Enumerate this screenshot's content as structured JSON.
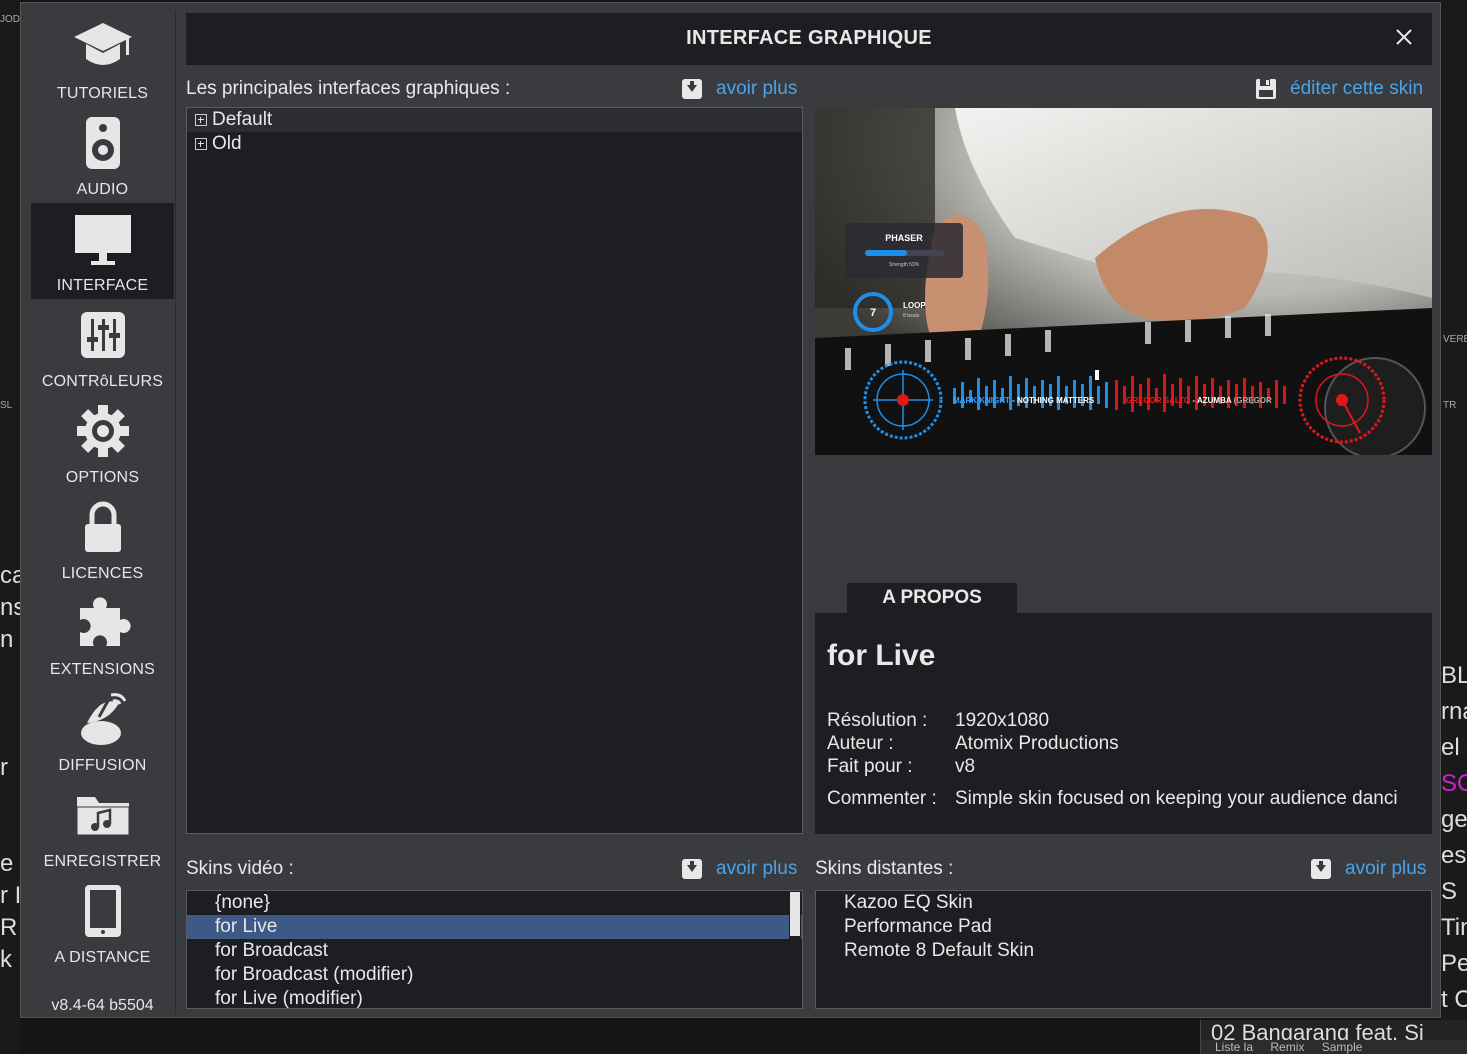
{
  "dialog": {
    "title": "INTERFACE GRAPHIQUE",
    "version": "v8.4-64 b5504"
  },
  "sidebar": {
    "items": [
      {
        "label": "TUTORIELS",
        "icon": "graduation-cap-icon"
      },
      {
        "label": "AUDIO",
        "icon": "speaker-icon"
      },
      {
        "label": "INTERFACE",
        "icon": "monitor-icon",
        "active": true
      },
      {
        "label": "CONTRôLEURS",
        "icon": "mixer-sliders-icon"
      },
      {
        "label": "OPTIONS",
        "icon": "gear-icon"
      },
      {
        "label": "LICENCES",
        "icon": "lock-icon"
      },
      {
        "label": "EXTENSIONS",
        "icon": "puzzle-icon"
      },
      {
        "label": "DIFFUSION",
        "icon": "satellite-dish-icon"
      },
      {
        "label": "ENREGISTRER",
        "icon": "music-folder-icon"
      },
      {
        "label": "A DISTANCE",
        "icon": "tablet-icon"
      }
    ]
  },
  "main_skins": {
    "label": "Les principales interfaces graphiques :",
    "more_link": "avoir plus",
    "edit_link": "éditer cette skin",
    "tree": [
      "Default",
      "Old"
    ]
  },
  "preview": {
    "fx_name": "PHASER",
    "fx_strength": "Strength 53%",
    "fx_level": 0.53,
    "loop_count": "7",
    "loop_label": "LOOP",
    "loop_sub": "8 beats",
    "deck_left_artist": "MARK KNIGHT",
    "deck_left_title": "- NOTHING MATTERS",
    "deck_right_artist": "GREGOR SALTO",
    "deck_right_title": "- AZUMBA",
    "deck_right_extra": "(GREGOR"
  },
  "about": {
    "tab": "A PROPOS",
    "name": "for Live",
    "resolution_label": "Résolution :",
    "resolution": "1920x1080",
    "author_label": "Auteur :",
    "author": "Atomix Productions",
    "made_for_label": "Fait pour :",
    "made_for": "v8",
    "comment_label": "Commenter :",
    "comment": "Simple skin focused on keeping your audience danci"
  },
  "video_skins": {
    "label": "Skins vidéo :",
    "more_link": "avoir plus",
    "items": [
      "{none}",
      "for Live",
      "for Broadcast",
      "for Broadcast (modifier)",
      "for Live (modifier)"
    ],
    "selected_index": 1
  },
  "remote_skins": {
    "label": "Skins distantes :",
    "more_link": "avoir plus",
    "items": [
      "Kazoo EQ Skin",
      "Performance Pad",
      "Remote 8 Default Skin"
    ]
  },
  "background": {
    "left_frags": [
      "JOD",
      "SL",
      "ca",
      "ns",
      "n I",
      "r",
      "e",
      "r I",
      "R",
      "k ("
    ],
    "right_frags": [
      "VERB",
      "TR",
      "BL",
      "rna",
      "el J",
      "SO",
      "ge I",
      "es",
      "S",
      "Tin",
      "Pe",
      "t C"
    ],
    "track_title": "02 Bangarang feat. Si",
    "track_tabs": [
      "Liste la",
      "Remix",
      "Sample"
    ]
  },
  "colors": {
    "accent_link": "#4aa3e8",
    "selection": "#3d5a86",
    "panel": "#1d1e21",
    "dialog_bg": "#3a3b3f",
    "magenta_fragment": "#d020d0"
  }
}
